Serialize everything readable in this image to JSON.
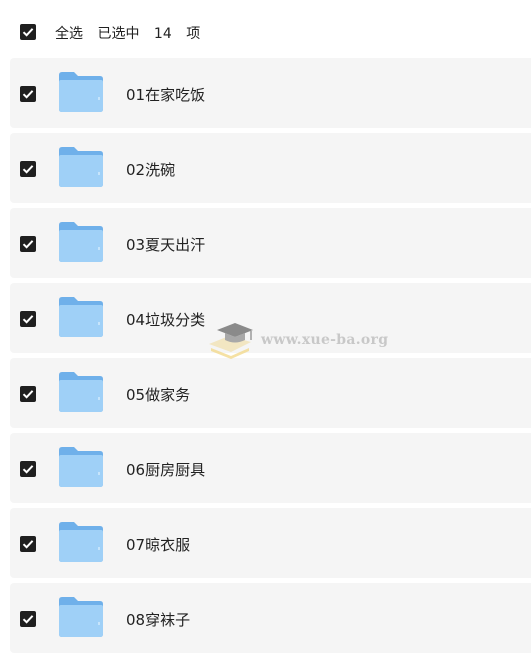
{
  "header": {
    "select_all_label": "全选",
    "selected_label": "已选中",
    "selected_count": "14",
    "items_unit": "项"
  },
  "items": [
    {
      "label": "01在家吃饭"
    },
    {
      "label": "02洗碗"
    },
    {
      "label": "03夏天出汗"
    },
    {
      "label": "04垃圾分类"
    },
    {
      "label": "05做家务"
    },
    {
      "label": "06厨房厨具"
    },
    {
      "label": "07晾衣服"
    },
    {
      "label": "08穿袜子"
    }
  ],
  "watermark": {
    "text": "www.xue-ba.org"
  },
  "colors": {
    "row_bg": "#f5f5f5",
    "checkbox": "#1f1f1f",
    "folder_back": "#6fb0ea",
    "folder_front": "#9fd0f7"
  }
}
